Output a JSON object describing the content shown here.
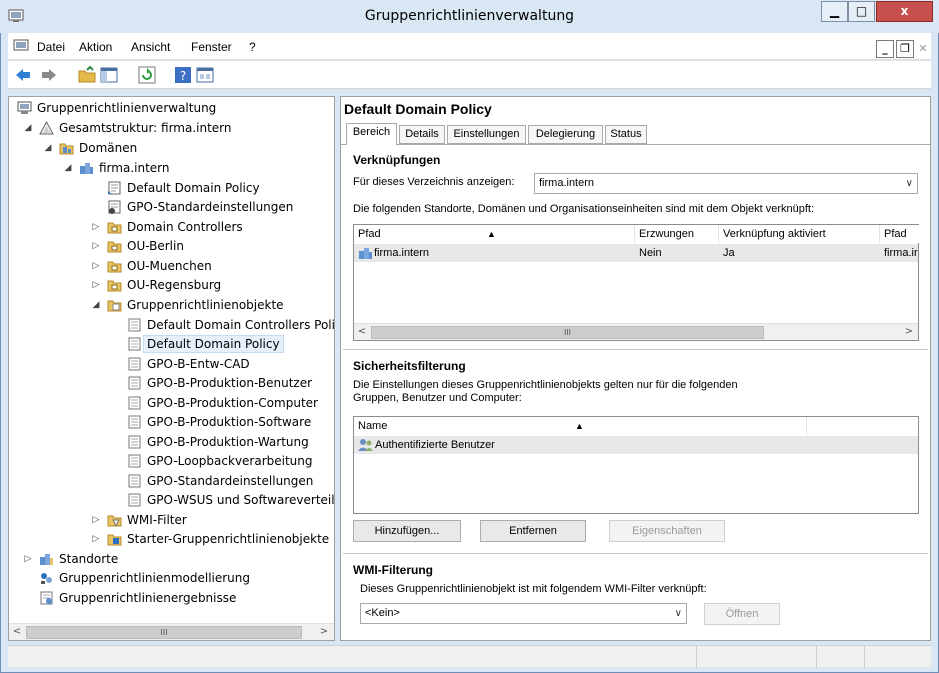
{
  "window": {
    "title": "Gruppenrichtlinienverwaltung",
    "min_label": "▁",
    "max_label": "□",
    "close_label": "x"
  },
  "menu": {
    "items": [
      "Datei",
      "Aktion",
      "Ansicht",
      "Fenster",
      "?"
    ]
  },
  "tree": {
    "root": "Gruppenrichtlinienverwaltung",
    "forest": "Gesamtstruktur: firma.intern",
    "domains": "Domänen",
    "domain": "firma.intern",
    "default_domain_policy": "Default Domain Policy",
    "gpo_std": "GPO-Standardeinstellungen",
    "domain_controllers": "Domain Controllers",
    "ou_berlin": "OU-Berlin",
    "ou_muenchen": "OU-Muenchen",
    "ou_regensburg": "OU-Regensburg",
    "gpo_objects": "Gruppenrichtlinienobjekte",
    "gpos": [
      "Default Domain Controllers Polic",
      "Default Domain Policy",
      "GPO-B-Entw-CAD",
      "GPO-B-Produktion-Benutzer",
      "GPO-B-Produktion-Computer",
      "GPO-B-Produktion-Software",
      "GPO-B-Produktion-Wartung",
      "GPO-Loopbackverarbeitung",
      "GPO-Standardeinstellungen",
      "GPO-WSUS und Softwareverteilu"
    ],
    "wmi_filter": "WMI-Filter",
    "starter_gpos": "Starter-Gruppenrichtlinienobjekte",
    "sites": "Standorte",
    "modeling": "Gruppenrichtlinienmodellierung",
    "results": "Gruppenrichtlinienergebnisse",
    "scroll_thumb": "III"
  },
  "detail": {
    "title": "Default Domain Policy",
    "tabs": [
      "Bereich",
      "Details",
      "Einstellungen",
      "Delegierung",
      "Status"
    ],
    "links": {
      "heading": "Verknüpfungen",
      "show_label": "Für dieses Verzeichnis anzeigen:",
      "show_value": "firma.intern",
      "info": "Die folgenden Standorte, Domänen und Organisationseinheiten sind mit dem Objekt verknüpft:",
      "columns": [
        "Pfad",
        "Erzwungen",
        "Verknüpfung aktiviert",
        "Pfad"
      ],
      "rows": [
        [
          "firma.intern",
          "Nein",
          "Ja",
          "firma.ir"
        ]
      ],
      "scroll_thumb": "III"
    },
    "security": {
      "heading": "Sicherheitsfilterung",
      "info_line1": "Die Einstellungen dieses Gruppenrichtlinienobjekts gelten nur für die folgenden",
      "info_line2": "Gruppen, Benutzer und Computer:",
      "column": "Name",
      "rows": [
        "Authentifizierte Benutzer"
      ],
      "add_button": "Hinzufügen...",
      "remove_button": "Entfernen",
      "properties_button": "Eigenschaften"
    },
    "wmi": {
      "heading": "WMI-Filterung",
      "info": "Dieses Gruppenrichtlinienobjekt ist mit folgendem WMI-Filter verknüpft:",
      "value": "<Kein>",
      "open_button": "Öffnen"
    }
  },
  "colors": {
    "frame": "#d9e6f4",
    "close": "#c7504d",
    "selection": "#e5f0fb"
  }
}
